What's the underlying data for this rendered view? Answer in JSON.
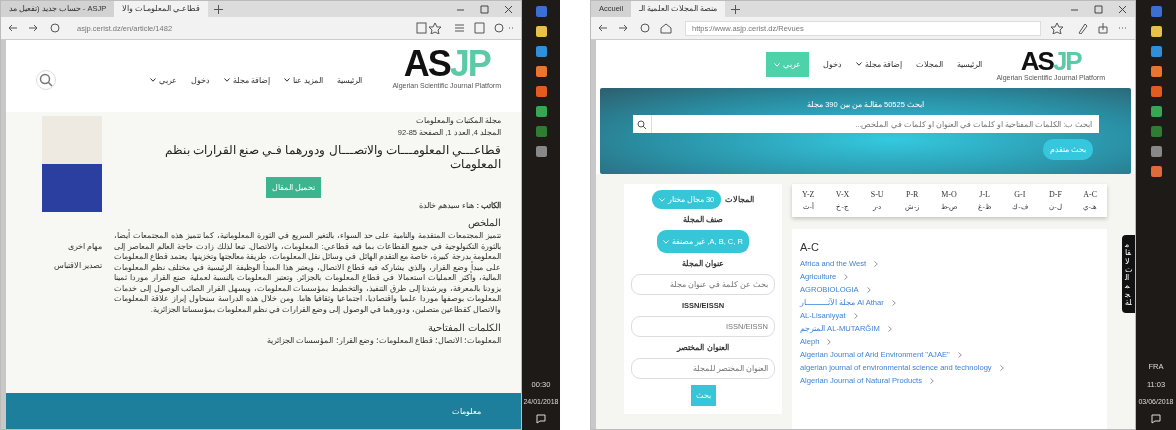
{
  "left_screen": {
    "browser": {
      "tabs": [
        {
          "label": "قطاعـي المعلومـات والا",
          "selected": true
        },
        {
          "label": "حساب جديد (تفعيل مد - ASJP",
          "selected": false
        }
      ],
      "url": "asjp.cerist.dz/en/article/1482"
    },
    "logo": {
      "main": "AS",
      "accent": "JP",
      "subtitle": "Algerian Scientific Journal Platform"
    },
    "nav": [
      {
        "label": "الرئيسية",
        "dropdown": false
      },
      {
        "label": "المزيد عنا",
        "dropdown": true
      },
      {
        "label": "إضافة مجلة",
        "dropdown": true
      },
      {
        "label": "دخول",
        "dropdown": false
      },
      {
        "label": "عربي",
        "dropdown": true
      }
    ],
    "article": {
      "journal": "مجلة المكتبات والمعلومات",
      "issue": "المجلد 4, العدد 1, الصفحة 85-92",
      "title": "قطاعـــي المعلومـــات والاتصـــال ودورهما فـي صنع القرارات بنظم المعلومات",
      "download_button": "تحميل المقال",
      "author": "**الكاتب :** هناء سيدهم خالدة",
      "abstract_heading": "الملخص",
      "abstract": "تتميز المجتمعات المتقدمة والنامية على حد السواء، بالتغير السريع في الثورة المعلوماتية، كما تتميز هذه المجتمعات أيضا، بالثورة التكنولوجية في جميع القطاعات بما فيه قطاعي: المعلومات، والاتصال. تبعا لذلك زادت حاجة العالم المعاصر إلى المعلومة بدرجة كبيرة، خاصة مع التقدم الهائل في وسائل نقل المعلومات، طريقة معالجتها وتخزينها. يعتمد قطاع المعلومات على مبدأ وضع القرار، والذي يشاركه فيه قطاع الاتصال، ويعتبر هذا المبدأ الوظيفة الرئيسية في مختلف نظم المعلومات المالية، وأكثر العمليات استعمالا في قطاع المعلومات بالجزائر. وتعتبر المعلومات بالنسبة لعملية صنع القرار موردا ثمينا يزودنا بالمعرفة، ويرشدنا إلى طرق التنفيذ، والتخطيط بمؤسسات المعلومات، ويسهل القرار الصائب الوصول إلى خدمات المعلومات بوصفها موردا علميا واقتصاديا، اجتماعيا وثقافيا هاما. ومن خلال هذه الدراسة سنحاول إبراز علاقة المعلومات والاتصال كقطاعين متصلين، ودورهما في الوصول إلى وضع القرارات في نظم المعلومات بمؤسساتنا الجزائرية.",
      "keywords_heading": "الكلمات المفتاحية",
      "keywords": "المعلومات؛ الاتصال؛ قطاع المعلومات؛ وضع القرار؛ المؤسسات الجزائرية"
    },
    "side_links": [
      "مهام اخرى",
      "تصدير الاقتباس"
    ],
    "footer": "معلومات",
    "taskbar": {
      "time": "00:30",
      "date": "24/01/2018"
    }
  },
  "right_screen": {
    "browser": {
      "tabs": [
        {
          "label": "منصة المجلات العلمية الـ",
          "selected": true
        },
        {
          "label": "Accueil",
          "selected": false
        }
      ],
      "url": "https://www.asjp.cerist.dz/Revues"
    },
    "logo": {
      "main": "AS",
      "accent": "JP",
      "subtitle": "Algerian Scientific Journal Platform"
    },
    "nav": [
      {
        "label": "الرئيسية",
        "dropdown": false
      },
      {
        "label": "المجلات",
        "dropdown": false
      },
      {
        "label": "إضافة مجلة",
        "dropdown": true
      },
      {
        "label": "دخول",
        "dropdown": false
      }
    ],
    "language_button": "عربي",
    "hero": {
      "headline": "ابحث 50525 مقالـة من بين 390 مجلة",
      "placeholder": "ابحث ب: الكلمات المفتاحية أو كلمات في العنوان أو كلمات في الملخص...",
      "advanced_button": "بحث متقدم"
    },
    "filters": {
      "fields_label": "المجالات",
      "fields_value": "30 مجال مختار",
      "class_label": "صنف المجلة",
      "class_value": "A, B, C, R, غير مصنفة",
      "inputs": [
        {
          "label": "عنوان المجلة",
          "placeholder": "بحث عن كلمة في عنوان مجلة"
        },
        {
          "label": "ISSN/EISSN",
          "placeholder": "ISSN/EISSN"
        },
        {
          "label": "العنوان المختصر",
          "placeholder": "العنوان المختصر للمجلة"
        }
      ],
      "search_button": "بحث"
    },
    "letter_tabs": [
      {
        "latin": "A-C",
        "arabic": "هـ-ي"
      },
      {
        "latin": "D-F",
        "arabic": "ل-ن"
      },
      {
        "latin": "G-I",
        "arabic": "ف-ك"
      },
      {
        "latin": "J-L",
        "arabic": "ظ-غ"
      },
      {
        "latin": "M-O",
        "arabic": "ص-ط"
      },
      {
        "latin": "P-R",
        "arabic": "ز-ش"
      },
      {
        "latin": "S-U",
        "arabic": "د-ر"
      },
      {
        "latin": "V-X",
        "arabic": "ج-خ"
      },
      {
        "latin": "Y-Z",
        "arabic": "أ-ث"
      }
    ],
    "list_heading": "A-C",
    "journals": [
      "Africa and the West",
      "Agriculture",
      "AGROBIOLOGIA",
      "مجلة الآثـــــــــــار Al Athar",
      "AL-Lisaniyyat",
      "المترجم AL-MUTARĞIM",
      "Aleph",
      "Algerian Journal of Arid Environment \"AJAE\"",
      "algerian journal of environmental science and technology",
      "Algerian Journal of Natural Products"
    ],
    "side_tab": "مقالات المجلة",
    "taskbar": {
      "language": "FRA",
      "time": "11:03",
      "date": "03/06/2018"
    }
  }
}
